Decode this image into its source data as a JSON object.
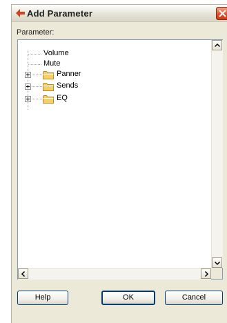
{
  "window": {
    "title": "Add Parameter"
  },
  "parameter_label": "Parameter:",
  "tree": {
    "items": [
      {
        "label": "Volume",
        "type": "leaf"
      },
      {
        "label": "Mute",
        "type": "leaf"
      },
      {
        "label": "Panner",
        "type": "folder",
        "expanded": false
      },
      {
        "label": "Sends",
        "type": "folder",
        "expanded": false
      },
      {
        "label": "EQ",
        "type": "folder",
        "expanded": false
      }
    ]
  },
  "buttons": {
    "help": "Help",
    "ok": "OK",
    "cancel": "Cancel"
  },
  "icons": {
    "app": "app-arrow-icon",
    "close": "close-icon",
    "folder": "folder-icon",
    "expand": "expand-plus-icon"
  },
  "colors": {
    "dialog_bg": "#ece9d8",
    "tree_border": "#7f9db9",
    "close_red": "#e14a26",
    "folder_yellow": "#f5d06a",
    "button_border": "#003c74"
  }
}
